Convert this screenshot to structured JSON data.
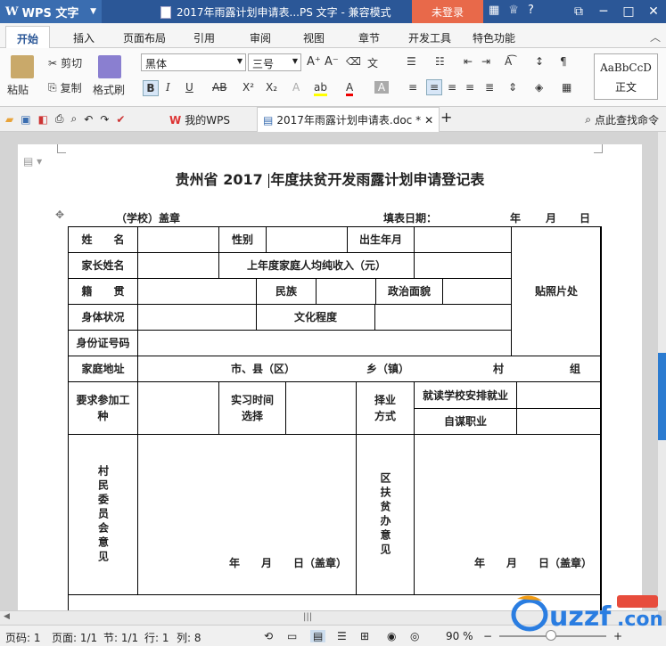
{
  "app": {
    "name": "WPS 文字",
    "doc_title": "2017年雨露计划申请表...PS 文字 - 兼容模式",
    "login": "未登录"
  },
  "menu": {
    "tabs": [
      "开始",
      "插入",
      "页面布局",
      "引用",
      "审阅",
      "视图",
      "章节",
      "开发工具",
      "特色功能"
    ]
  },
  "ribbon": {
    "paste": "粘贴",
    "cut": "剪切",
    "copy": "复制",
    "format_painter": "格式刷",
    "font_name": "黑体",
    "font_size": "三号",
    "style_sample": "AaBbCcD",
    "style_name": "正文"
  },
  "doctabs": {
    "mywps": "我的WPS",
    "doc": "2017年雨露计划申请表.doc *",
    "search": "点此查找命令"
  },
  "form": {
    "title_a": "贵州省 2017 ",
    "title_b": "年度扶贫开发雨露计划申请登记表",
    "school": "（学校）盖章",
    "fill_date": "填表日期：",
    "year": "年",
    "month": "月",
    "day": "日",
    "name": "姓　　名",
    "gender": "性别",
    "birth": "出生年月",
    "photo": "贴照片处",
    "parent": "家长姓名",
    "income": "上年度家庭人均纯收入（元）",
    "origin": "籍　　贯",
    "ethnic": "民族",
    "political": "政治面貌",
    "health": "身体状况",
    "education": "文化程度",
    "idno": "身份证号码",
    "address": "家庭地址",
    "addr_city": "市、县（区）",
    "addr_town": "乡（镇）",
    "addr_village": "村",
    "addr_group": "组",
    "job_req": "要求参加工种",
    "intern": "实习时间选择",
    "choice": "择业方式",
    "school_job": "就读学校安排就业",
    "self_job": "自谋职业",
    "village_opinion": "村民委员会意见",
    "district_opinion": "区扶贫办意见",
    "sign": "年　　月　　日（盖章）"
  },
  "status": {
    "page": "页码: 1",
    "pages": "页面: 1/1",
    "section": "节: 1/1",
    "row": "行: 1",
    "col": "列: 8",
    "zoom": "90 %"
  }
}
